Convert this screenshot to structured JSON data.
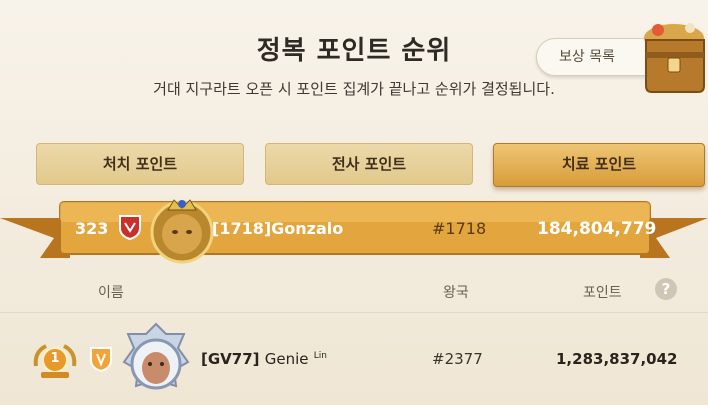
{
  "header": {
    "title": "정복 포인트 순위",
    "subtitle": "거대 지구라트 오픈 시 포인트 집계가 끝나고 순위가 결정됩니다.",
    "reward_button": "보상 목록"
  },
  "tabs": [
    {
      "label": "처치 포인트",
      "active": false
    },
    {
      "label": "전사 포인트",
      "active": false
    },
    {
      "label": "치료 포인트",
      "active": true
    }
  ],
  "my_rank": {
    "rank": "323",
    "name": "[1718]Gonzalo",
    "realm": "#1718",
    "points": "184,804,779"
  },
  "columns": {
    "name": "이름",
    "realm": "왕국",
    "points": "포인트"
  },
  "help_icon": "?",
  "rows": [
    {
      "rank": "1",
      "tag": "[GV77]",
      "name": "Genie",
      "suffix": "Lin",
      "realm": "#2377",
      "points": "1,283,837,042"
    }
  ],
  "colors": {
    "ribbon": "#e0a23a",
    "active_tab": "#d79c3a",
    "tab": "#e6cf98"
  }
}
